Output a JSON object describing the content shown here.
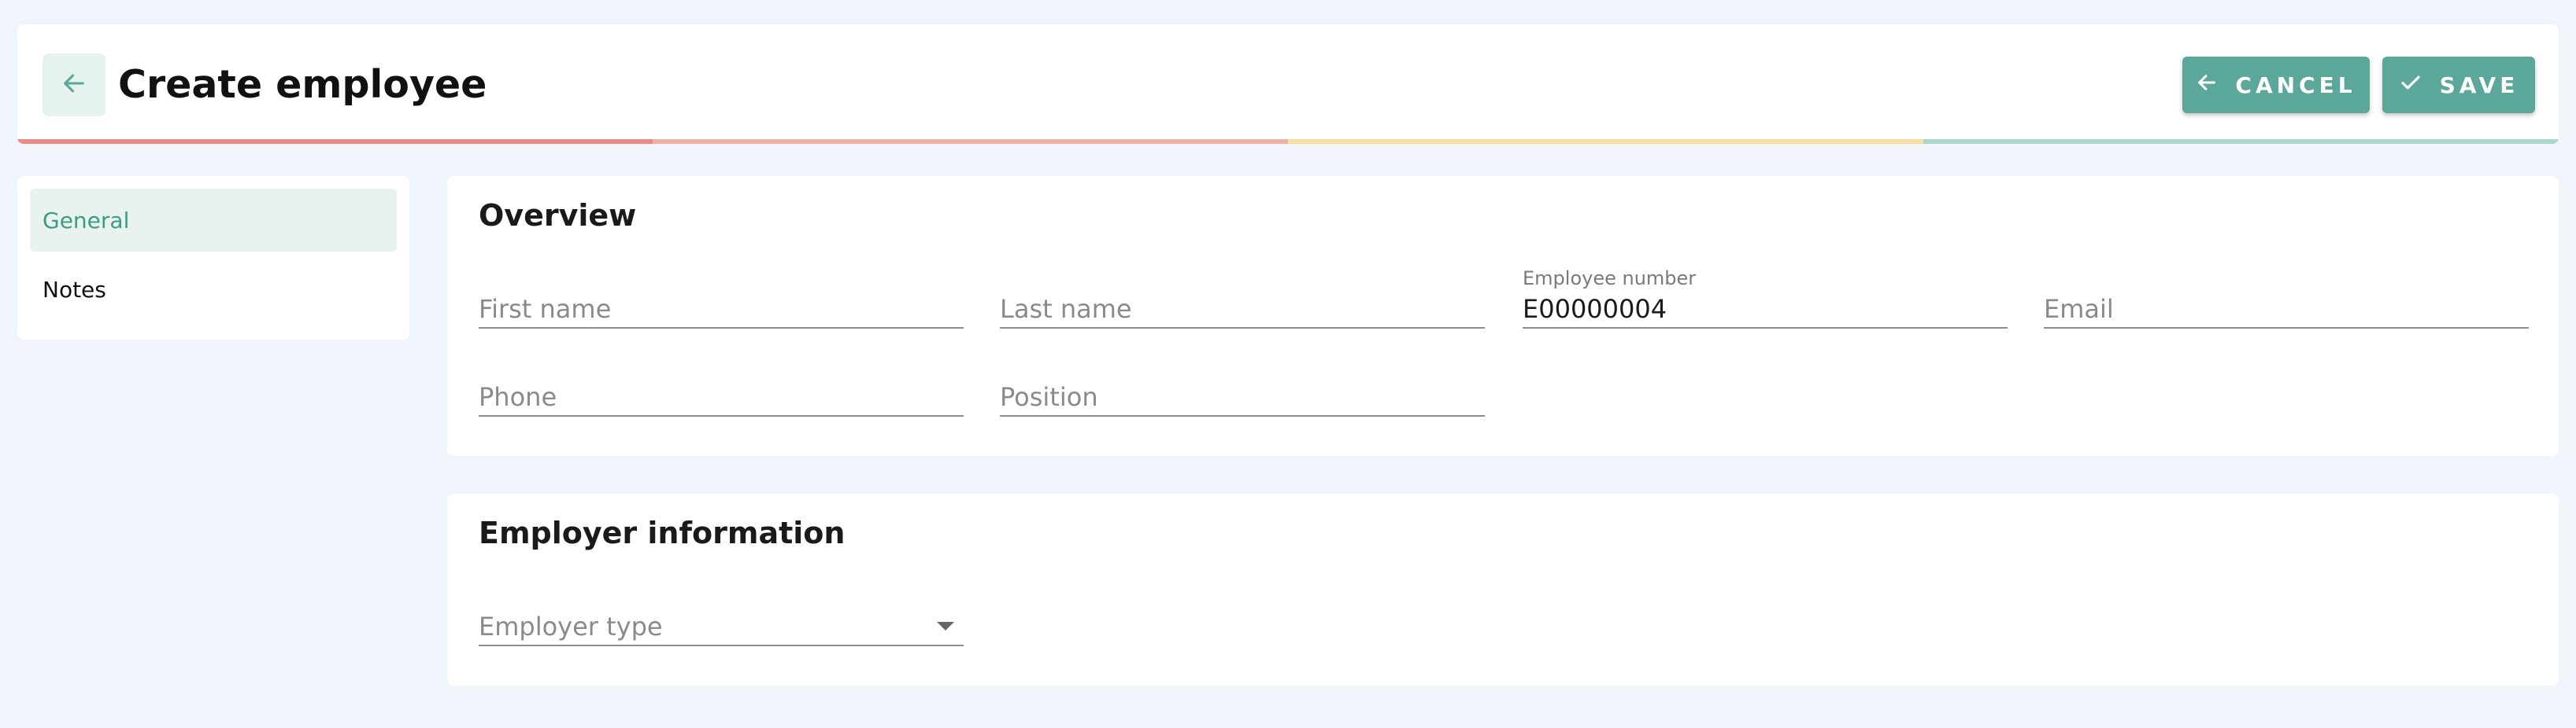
{
  "header": {
    "title": "Create employee",
    "back_icon": "arrow-left-icon",
    "cancel_label": "CANCEL",
    "cancel_icon": "arrow-left-icon",
    "save_label": "SAVE",
    "save_icon": "check-icon",
    "progress_colors": [
      "#ef8a86",
      "#f5aca1",
      "#f6dfa1",
      "#a9d9cc"
    ]
  },
  "sidebar": {
    "items": [
      {
        "label": "General",
        "active": true
      },
      {
        "label": "Notes",
        "active": false
      }
    ]
  },
  "overview": {
    "title": "Overview",
    "fields": {
      "first_name": {
        "placeholder": "First name"
      },
      "last_name": {
        "placeholder": "Last name"
      },
      "employee_number": {
        "label": "Employee number",
        "value": "E00000004"
      },
      "email": {
        "placeholder": "Email"
      },
      "phone": {
        "placeholder": "Phone"
      },
      "position": {
        "placeholder": "Position"
      }
    }
  },
  "employer": {
    "title": "Employer information",
    "employer_type": {
      "placeholder": "Employer type",
      "icon": "chevron-down-icon"
    }
  },
  "colors": {
    "accent": "#5ba79a",
    "accent_light": "#e8f3ef",
    "background": "#f0f4fb"
  }
}
